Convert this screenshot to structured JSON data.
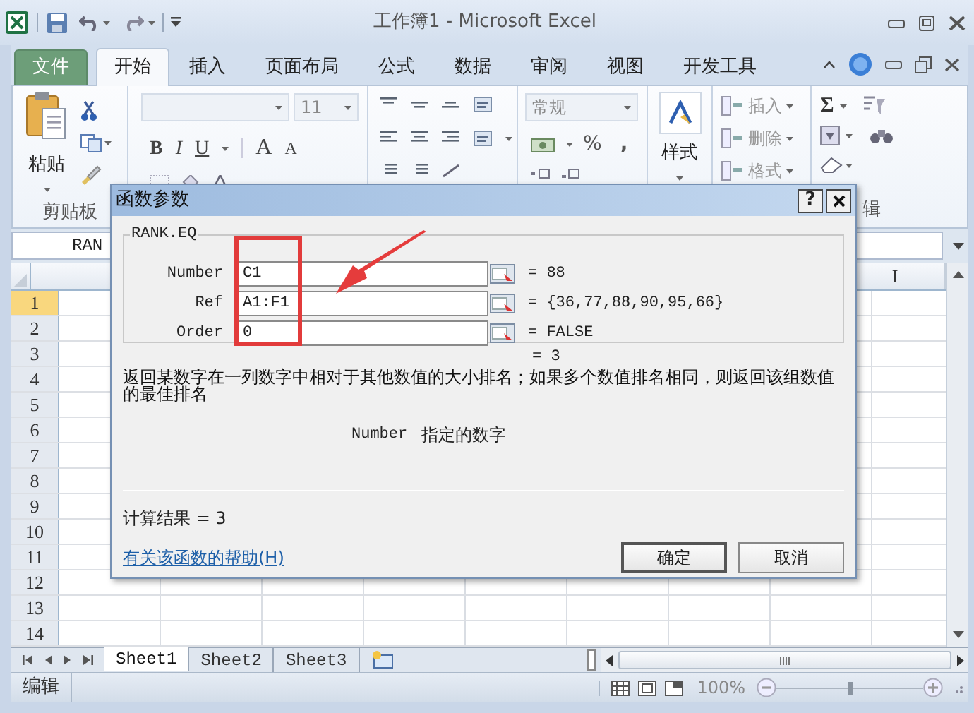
{
  "window": {
    "title": "工作簿1 - Microsoft Excel"
  },
  "ribbon_tabs": [
    {
      "label": "文件",
      "kind": "file",
      "selected": false
    },
    {
      "label": "开始",
      "kind": "tab",
      "selected": true
    },
    {
      "label": "插入",
      "kind": "tab",
      "selected": false
    },
    {
      "label": "页面布局",
      "kind": "tab",
      "selected": false
    },
    {
      "label": "公式",
      "kind": "tab",
      "selected": false
    },
    {
      "label": "数据",
      "kind": "tab",
      "selected": false
    },
    {
      "label": "审阅",
      "kind": "tab",
      "selected": false
    },
    {
      "label": "视图",
      "kind": "tab",
      "selected": false
    },
    {
      "label": "开发工具",
      "kind": "tab",
      "selected": false
    }
  ],
  "ribbon": {
    "paste_label": "粘贴",
    "clipboard_label": "剪贴板",
    "font_size": "11",
    "font_styles": [
      "B",
      "I",
      "U"
    ],
    "font_sizers": [
      "A",
      "A"
    ],
    "number_format": "常规",
    "number_symbols": [
      "%",
      ","
    ],
    "styles_label": "样式",
    "cell_commands": [
      "插入",
      "删除",
      "格式"
    ],
    "sum_symbol": "Σ",
    "editing_label": "辑"
  },
  "name_box": "RAN",
  "column_header": "I",
  "rows": [
    {
      "label": "1",
      "selected": true
    },
    {
      "label": "2",
      "selected": false
    },
    {
      "label": "3",
      "selected": false
    },
    {
      "label": "4",
      "selected": false
    },
    {
      "label": "5",
      "selected": false
    },
    {
      "label": "6",
      "selected": false
    },
    {
      "label": "7",
      "selected": false
    },
    {
      "label": "8",
      "selected": false
    },
    {
      "label": "9",
      "selected": false
    },
    {
      "label": "10",
      "selected": false
    },
    {
      "label": "11",
      "selected": false
    },
    {
      "label": "12",
      "selected": false
    },
    {
      "label": "13",
      "selected": false
    },
    {
      "label": "14",
      "selected": false
    }
  ],
  "sheet_tabs": [
    {
      "label": "Sheet1",
      "selected": true
    },
    {
      "label": "Sheet2",
      "selected": false
    },
    {
      "label": "Sheet3",
      "selected": false
    }
  ],
  "status_bar": {
    "mode": "编辑",
    "zoom": "100%",
    "zoom_slider": {
      "level": 0.5
    }
  },
  "dialog": {
    "title": "函数参数",
    "help_button": "?",
    "function": "RANK.EQ",
    "arguments": [
      {
        "label": "Number",
        "value": "C1",
        "result": "= 88"
      },
      {
        "label": "Ref",
        "value": "A1:F1",
        "result": "= {36,77,88,90,95,66}"
      },
      {
        "label": "Order",
        "value": "0",
        "result": "= FALSE"
      }
    ],
    "result": "= 3",
    "description": "返回某数字在一列数字中相对于其他数值的大小排名；如果多个数值排名相同，则返回该组数值的最佳排名",
    "argument_help": {
      "name": "Number",
      "text": "指定的数字"
    },
    "formula_result": "计算结果 = 3",
    "help_link": "有关该函数的帮助(H)",
    "buttons": [
      "确定",
      "取消"
    ]
  }
}
